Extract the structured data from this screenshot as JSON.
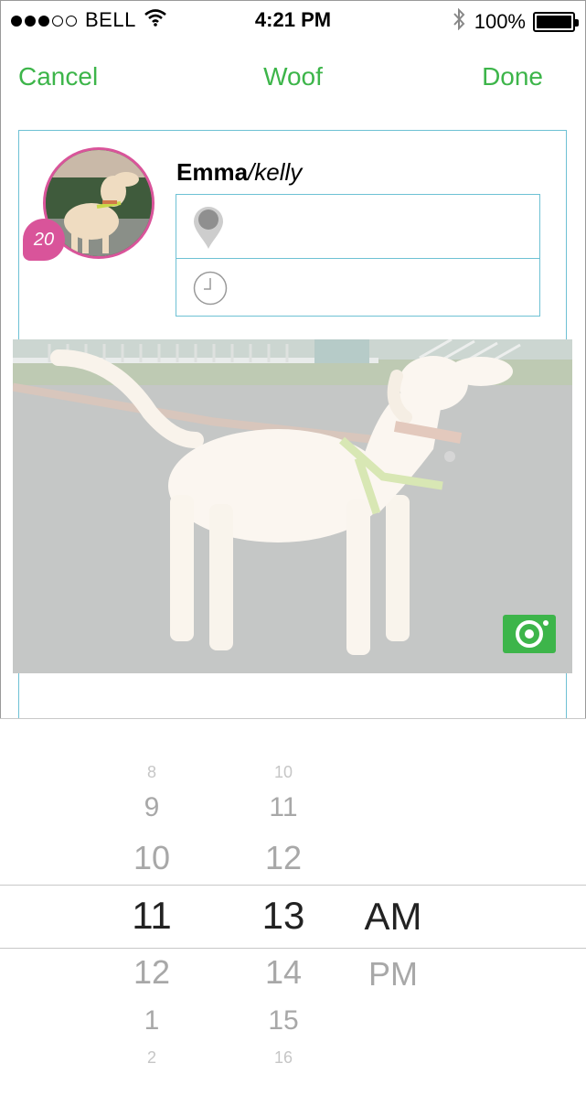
{
  "status_bar": {
    "carrier": "BELL",
    "time": "4:21 PM",
    "battery": "100%",
    "signal_bars_filled": 3,
    "signal_bars_total": 5
  },
  "nav": {
    "cancel_label": "Cancel",
    "title": "Woof",
    "done_label": "Done"
  },
  "post": {
    "user_name": "Emma",
    "separator": "/",
    "dog_name": "kelly",
    "badge_count": "20",
    "location_value": "",
    "time_value": ""
  },
  "icons": {
    "location": "map-pin-icon",
    "time": "clock-icon",
    "camera": "camera-icon",
    "wifi": "wifi-icon",
    "bluetooth": "bluetooth-icon",
    "battery": "battery-icon"
  },
  "colors": {
    "accent_green": "#3db54a",
    "avatar_pink": "#d9549a",
    "field_border": "#6ec1d4"
  },
  "time_picker": {
    "hours": [
      "8",
      "9",
      "10",
      "11",
      "12",
      "1",
      "2"
    ],
    "selected_hour": "11",
    "minutes": [
      "10",
      "11",
      "12",
      "13",
      "14",
      "15",
      "16"
    ],
    "selected_minute": "13",
    "periods": [
      "AM",
      "PM"
    ],
    "selected_period": "AM"
  }
}
